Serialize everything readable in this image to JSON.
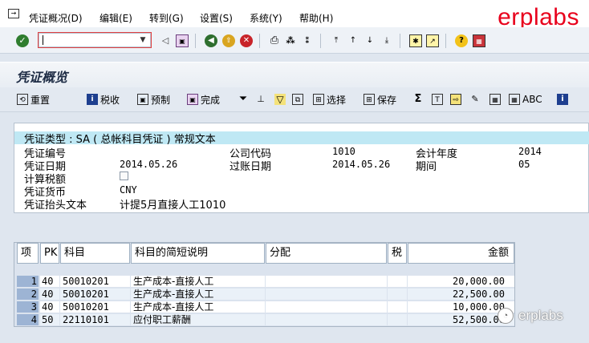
{
  "menu": {
    "items": [
      "凭证概况(D)",
      "编辑(E)",
      "转到(G)",
      "设置(S)",
      "系统(Y)",
      "帮助(H)"
    ]
  },
  "brand": "erplabs",
  "command_field": {
    "value": ""
  },
  "page_title": "凭证概览",
  "app_toolbar": {
    "reset": "重置",
    "tax": "税收",
    "park": "预制",
    "complete": "完成",
    "select": "选择",
    "save": "保存",
    "abc": "ABC"
  },
  "header": {
    "doc_type_line": "凭证类型 : SA ( 总帐科目凭证 ) 常规文本",
    "doc_no_label": "凭证编号",
    "company_label": "公司代码",
    "company_value": "1010",
    "fiscal_year_label": "会计年度",
    "fiscal_year_value": "2014",
    "doc_date_label": "凭证日期",
    "doc_date_value": "2014.05.26",
    "posting_date_label": "过账日期",
    "posting_date_value": "2014.05.26",
    "period_label": "期间",
    "period_value": "05",
    "calc_tax_label": "计算税额",
    "calc_tax_checked": false,
    "currency_label": "凭证货币",
    "currency_value": "CNY",
    "header_text_label": "凭证抬头文本",
    "header_text_value": "计提5月直接人工1010"
  },
  "table": {
    "columns": [
      "项",
      "PK",
      "科目",
      "科目的简短说明",
      "分配",
      "税",
      "金额"
    ],
    "rows": [
      {
        "idx": "1",
        "pk": "40",
        "account": "50010201",
        "desc": "生产成本-直接人工",
        "assign": "",
        "tax": "",
        "amount": "20,000.00"
      },
      {
        "idx": "2",
        "pk": "40",
        "account": "50010201",
        "desc": "生产成本-直接人工",
        "assign": "",
        "tax": "",
        "amount": "22,500.00"
      },
      {
        "idx": "3",
        "pk": "40",
        "account": "50010201",
        "desc": "生产成本-直接人工",
        "assign": "",
        "tax": "",
        "amount": "10,000.00"
      },
      {
        "idx": "4",
        "pk": "50",
        "account": "22110101",
        "desc": "应付职工薪酬",
        "assign": "",
        "tax": "",
        "amount": "52,500.00"
      }
    ]
  },
  "watermark": "erplabs",
  "colors": {
    "brand": "#e8001c",
    "header_highlight": "#bfe8f4",
    "index_cell": "#9db4d4"
  }
}
